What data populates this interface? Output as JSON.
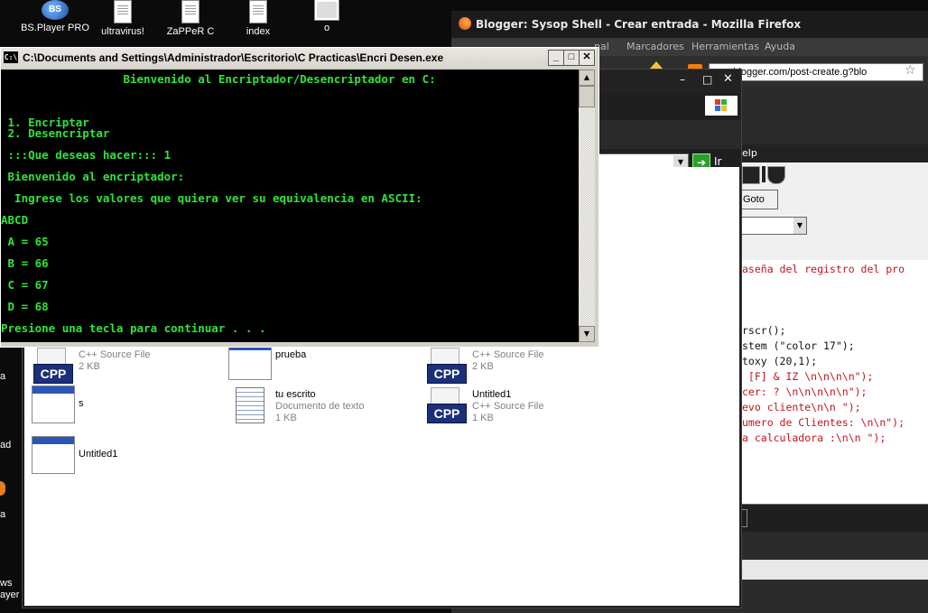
{
  "desktop_icons": [
    {
      "label": "BS.Player PRO",
      "icon": "bsplayer-icon"
    },
    {
      "label": "ultravirus!",
      "icon": "document-icon"
    },
    {
      "label": "ZaPPeR C",
      "icon": "document-icon"
    },
    {
      "label": "index",
      "icon": "document-icon"
    },
    {
      "label": "o",
      "icon": "image-icon"
    }
  ],
  "side_labels": [
    "a",
    "ad",
    "a",
    "ws",
    "ayer"
  ],
  "firefox": {
    "title": "Blogger: Sysop Shell - Crear entrada - Mozilla Firefox",
    "menu": [
      "nal",
      "Marcadores",
      "Herramientas",
      "Ayuda"
    ],
    "url": "www.blogger.com/post-create.g?blo"
  },
  "explorer": {
    "go_label": "Ir",
    "files": [
      {
        "name": "",
        "type": "C++ Source File",
        "size": "2 KB",
        "icon": "cpp-file-icon"
      },
      {
        "name": "prueba",
        "type": "",
        "size": "",
        "icon": "window-icon"
      },
      {
        "name": "",
        "type": "C++ Source File",
        "size": "2 KB",
        "icon": "cpp-file-icon"
      },
      {
        "name": "s",
        "type": "",
        "size": "",
        "icon": "window-icon"
      },
      {
        "name": "tu escrito",
        "type": "Documento de texto",
        "size": "1 KB",
        "icon": "notepad-icon"
      },
      {
        "name": "Untitled1",
        "type": "C++ Source File",
        "size": "1 KB",
        "icon": "cpp-file-icon"
      },
      {
        "name": "Untitled1",
        "type": "",
        "size": "",
        "icon": "window-icon"
      }
    ]
  },
  "editor": {
    "menu_label": "elp",
    "goto_label": "Goto",
    "code_lines": [
      {
        "text": "aseña del registro del pro",
        "color": "#c0141c"
      },
      {
        "text": "rscr();",
        "color": "#111111"
      },
      {
        "text": "stem (\"color 17\");",
        "color": "#111111"
      },
      {
        "text": "toxy (20,1);",
        "color": "#111111"
      },
      {
        "text": " [F] & IZ \\n\\n\\n\\n\");",
        "color": "#c0141c"
      },
      {
        "text": "cer: ? \\n\\n\\n\\n\\n\");",
        "color": "#c0141c"
      },
      {
        "text": "evo cliente\\n\\n \");",
        "color": "#c0141c"
      },
      {
        "text": "umero de Clientes: \\n\\n\");",
        "color": "#c0141c"
      },
      {
        "text": "a calculadora :\\n\\n \");",
        "color": "#c0141c"
      }
    ]
  },
  "console": {
    "title": "C:\\Documents and Settings\\Administrador\\Escritorio\\C Practicas\\Encri Desen.exe",
    "lines": [
      "                  Bienvenido al Encriptador/Desencriptador en C:",
      "",
      "",
      "",
      " 1. Encriptar",
      " 2. Desencriptar",
      "",
      " :::Que deseas hacer::: 1",
      "",
      " Bienvenido al encriptador:",
      "",
      "  Ingrese los valores que quiera ver su equivalencia en ASCII:",
      "",
      "ABCD",
      "",
      " A = 65",
      "",
      " B = 66",
      "",
      " C = 67",
      "",
      " D = 68",
      "Presione una tecla para continuar . . ."
    ]
  }
}
